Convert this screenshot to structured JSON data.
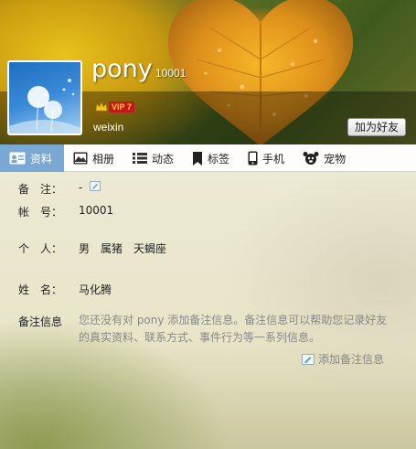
{
  "profile": {
    "nickname": "pony",
    "uin": "10001",
    "vip_label": "VIP 7",
    "wechat": "weixin",
    "add_friend_label": "加为好友"
  },
  "tabs": [
    {
      "label": "资料",
      "icon": "profile-card-icon",
      "active": true
    },
    {
      "label": "相册",
      "icon": "photo-album-icon",
      "active": false
    },
    {
      "label": "动态",
      "icon": "feed-list-icon",
      "active": false
    },
    {
      "label": "标签",
      "icon": "bookmark-tag-icon",
      "active": false
    },
    {
      "label": "手机",
      "icon": "mobile-phone-icon",
      "active": false
    },
    {
      "label": "宠物",
      "icon": "pet-icon",
      "active": false
    }
  ],
  "info": {
    "remark_label": "备　注：",
    "remark_value": "-",
    "account_label": "帐　号：",
    "account_value": "10001",
    "personal_label": "个　人：",
    "gender": "男",
    "zodiac": "属猪",
    "star_sign": "天蝎座",
    "name_label": "姓　名：",
    "name_value": "马化腾",
    "remark_info_label": "备注信息",
    "remark_info_text": "您还没有对 pony 添加备注信息。备注信息可以帮助您记录好友的真实资料、联系方式、事件行为等一系列信息。",
    "add_remark_label": "添加备注信息"
  }
}
